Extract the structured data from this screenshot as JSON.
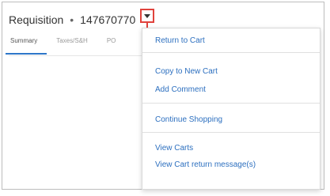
{
  "header": {
    "title": "Requisition",
    "separator": "•",
    "number": "147670770"
  },
  "tabs": [
    {
      "label": "Summary"
    },
    {
      "label": "Taxes/S&H"
    },
    {
      "label": "PO"
    }
  ],
  "menu": {
    "items": [
      {
        "label": "Return to Cart"
      },
      {
        "label": "Copy to New Cart"
      },
      {
        "label": "Add Comment"
      },
      {
        "label": "Continue Shopping"
      },
      {
        "label": "View Carts"
      },
      {
        "label": "View Cart return message(s)"
      }
    ]
  },
  "colors": {
    "link": "#2c6fbf",
    "highlight": "#e0423c",
    "tab_underline": "#2e77c9"
  },
  "icons": {
    "toggle": "caret-down-icon",
    "pointer": "red-arrow-icon"
  }
}
